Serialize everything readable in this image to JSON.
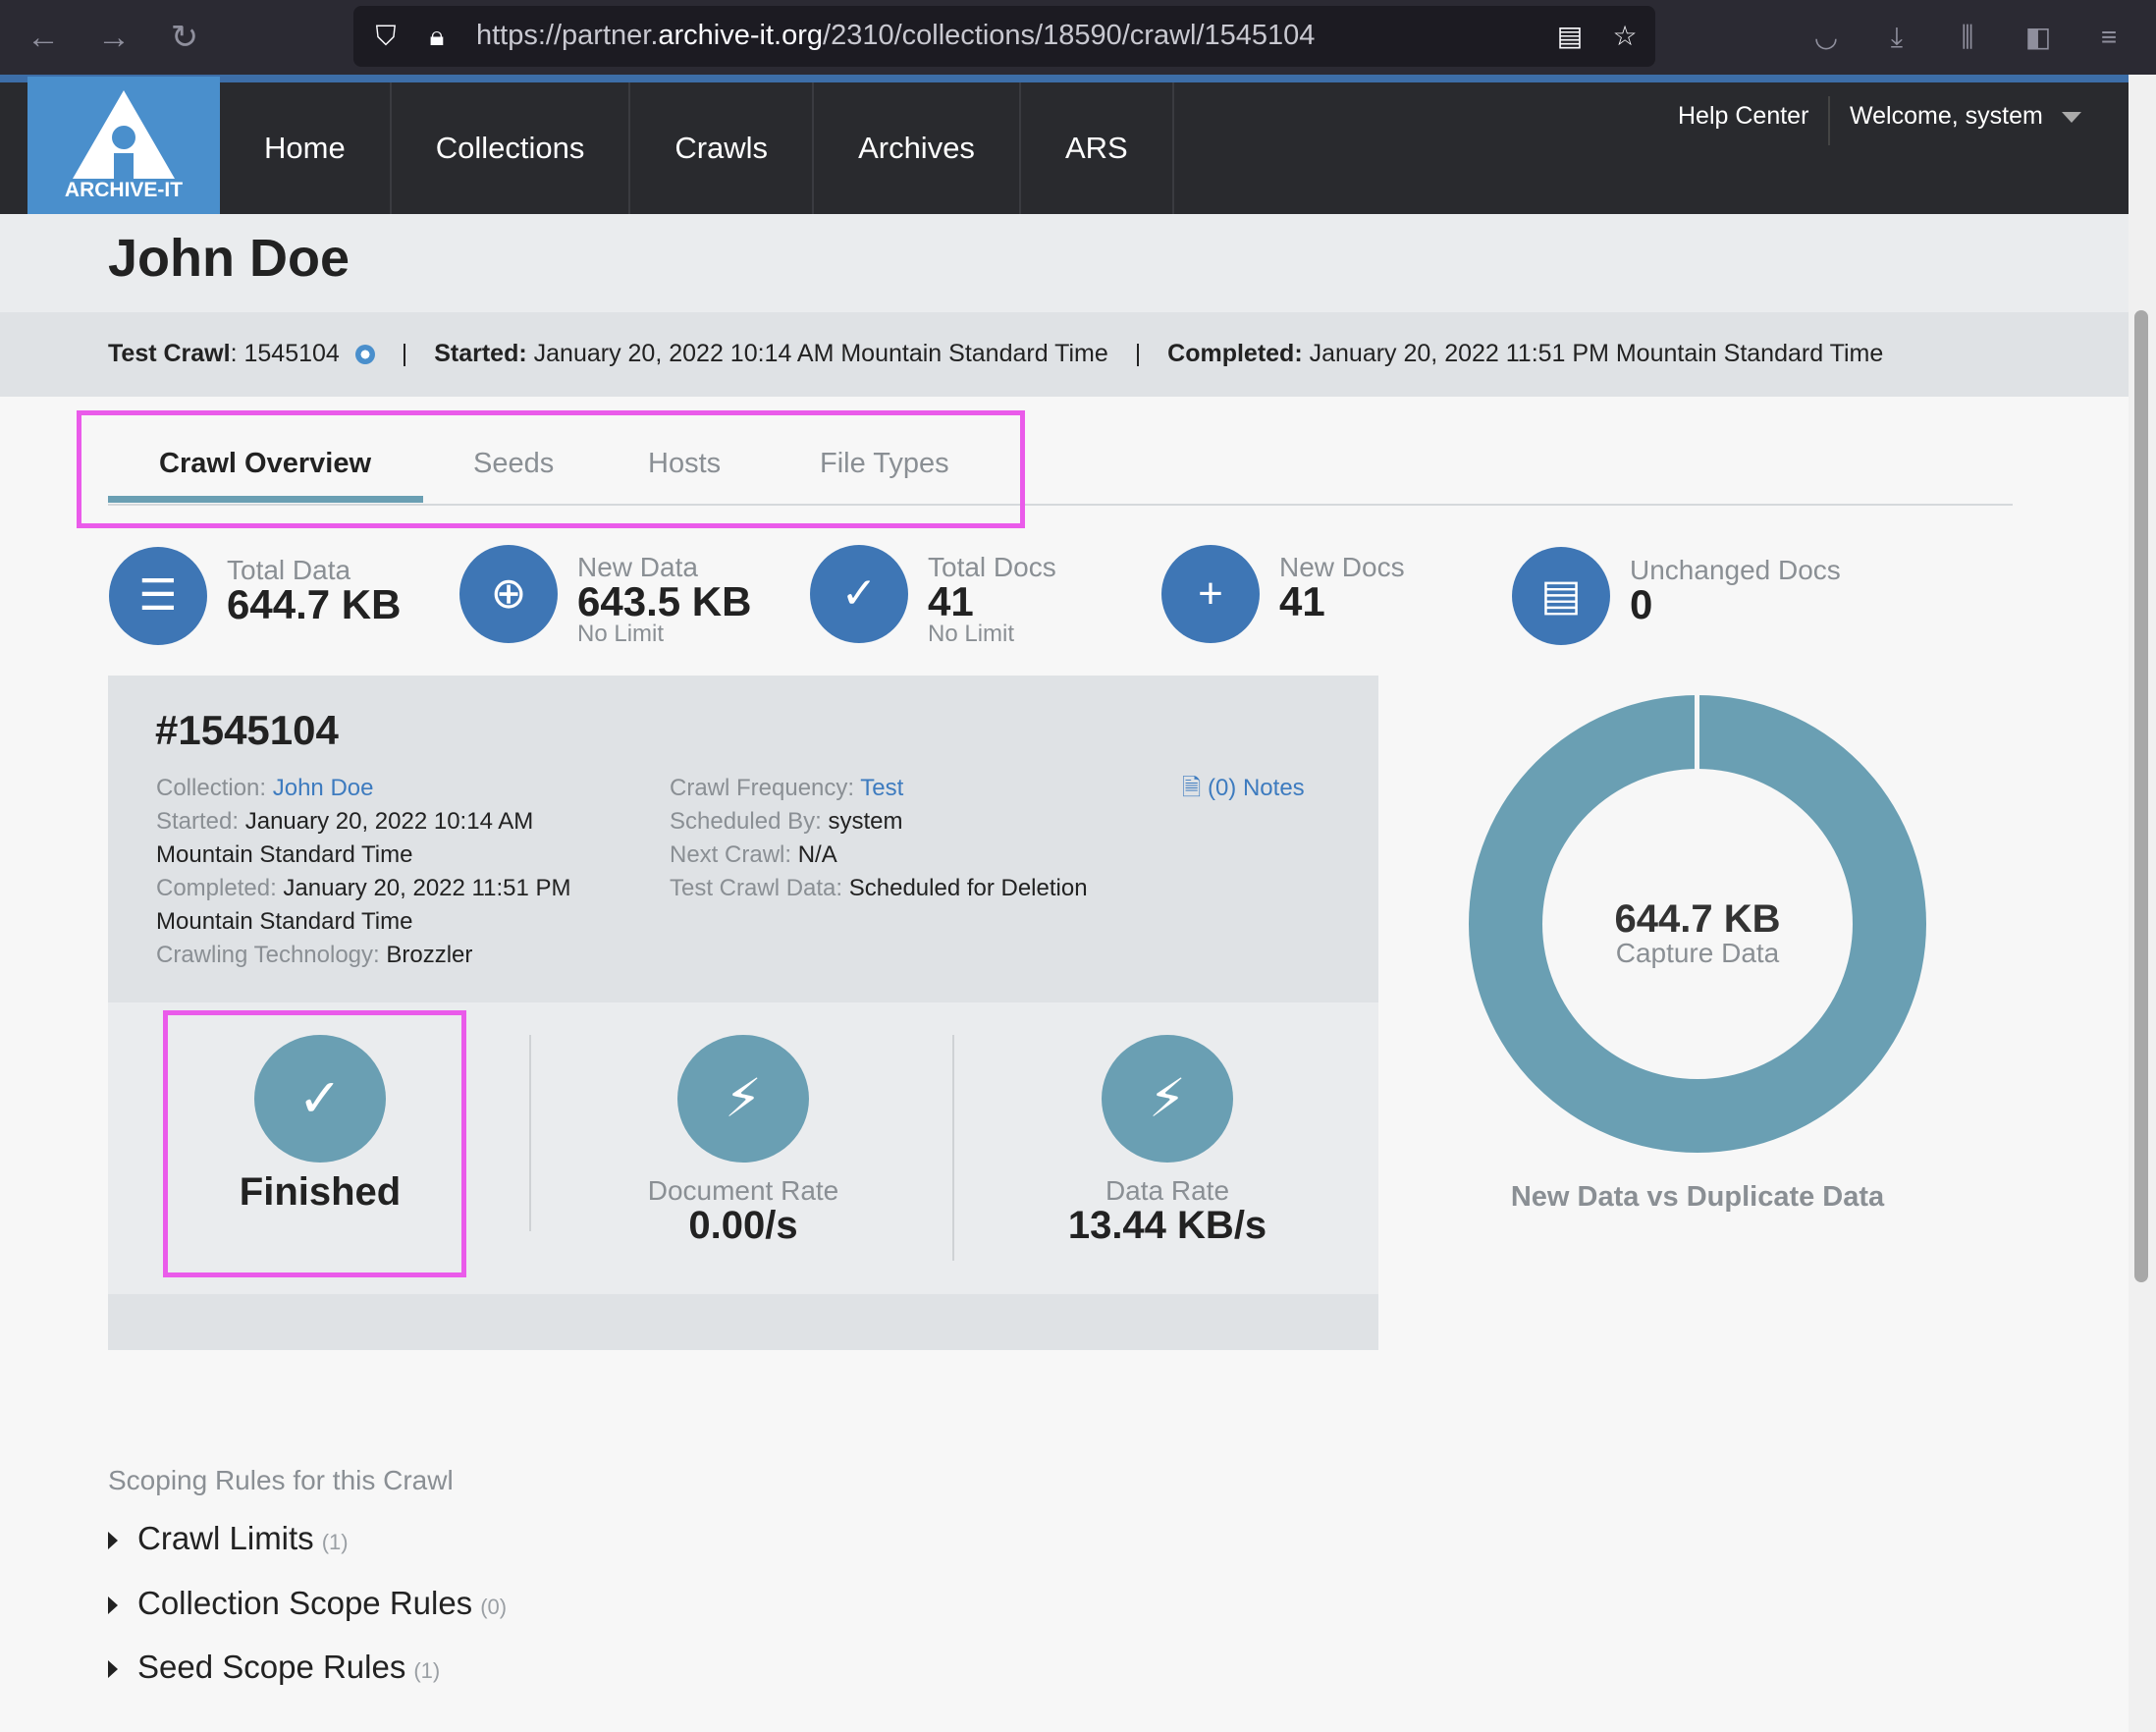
{
  "browser": {
    "url_prefix": "https://partner.",
    "url_host": "archive-it.org",
    "url_path": "/2310/collections/18590/crawl/1545104"
  },
  "site": {
    "logo_text": "ARCHIVE-IT",
    "nav": [
      "Home",
      "Collections",
      "Crawls",
      "Archives",
      "ARS"
    ],
    "help_center": "Help Center",
    "welcome": "Welcome, system"
  },
  "page": {
    "title": "John Doe",
    "meta": {
      "crawl_label": "Test Crawl",
      "crawl_id": "1545104",
      "started_label": "Started:",
      "started_value": "January 20, 2022 10:14 AM Mountain Standard Time",
      "completed_label": "Completed:",
      "completed_value": "January 20, 2022 11:51 PM Mountain Standard Time"
    }
  },
  "tabs": [
    "Crawl Overview",
    "Seeds",
    "Hosts",
    "File Types"
  ],
  "stats": [
    {
      "label": "Total Data",
      "value": "644.7 KB",
      "sub": "",
      "icon": "database-icon"
    },
    {
      "label": "New Data",
      "value": "643.5 KB",
      "sub": "No Limit",
      "icon": "database-add-icon"
    },
    {
      "label": "Total Docs",
      "value": "41",
      "sub": "No Limit",
      "icon": "document-check-icon"
    },
    {
      "label": "New Docs",
      "value": "41",
      "sub": "",
      "icon": "document-add-icon"
    },
    {
      "label": "Unchanged Docs",
      "value": "0",
      "sub": "",
      "icon": "document-icon"
    }
  ],
  "card": {
    "id": "#1545104",
    "collection_label": "Collection:",
    "collection_value": "John Doe",
    "started_label": "Started:",
    "started_value_1": "January 20, 2022 10:14 AM",
    "started_value_2": "Mountain Standard Time",
    "completed_label": "Completed:",
    "completed_value_1": "January 20, 2022 11:51 PM",
    "completed_value_2": "Mountain Standard Time",
    "tech_label": "Crawling Technology:",
    "tech_value": "Brozzler",
    "frequency_label": "Crawl Frequency:",
    "frequency_value": "Test",
    "scheduled_label": "Scheduled By:",
    "scheduled_value": "system",
    "next_label": "Next Crawl:",
    "next_value": "N/A",
    "testdata_label": "Test Crawl Data:",
    "testdata_value": "Scheduled for Deletion",
    "notes": "(0) Notes"
  },
  "status": {
    "state": "Finished",
    "doc_rate_label": "Document Rate",
    "doc_rate_value": "0.00/s",
    "data_rate_label": "Data Rate",
    "data_rate_value": "13.44 KB/s"
  },
  "chart_data": {
    "type": "pie",
    "title": "New Data vs Duplicate Data",
    "center_value": "644.7 KB",
    "center_label": "Capture Data"
  },
  "scoping": {
    "heading": "Scoping Rules for this Crawl",
    "items": [
      {
        "label": "Crawl Limits",
        "count": "(1)"
      },
      {
        "label": "Collection Scope Rules",
        "count": "(0)"
      },
      {
        "label": "Seed Scope Rules",
        "count": "(1)"
      }
    ]
  },
  "colors": {
    "accent": "#3e76b5",
    "teal": "#6a9fb3",
    "highlight": "#ea5bea",
    "link": "#3d7bbf"
  }
}
